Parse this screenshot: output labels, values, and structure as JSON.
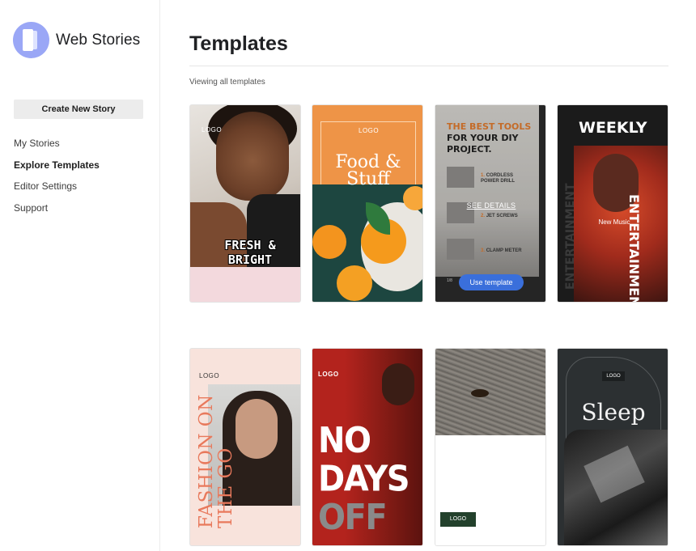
{
  "sidebar": {
    "brand": "Web Stories",
    "create_button": "Create New Story",
    "nav": [
      "My Stories",
      "Explore Templates",
      "Editor Settings",
      "Support"
    ],
    "active_index": 1
  },
  "main": {
    "title": "Templates",
    "viewing": "Viewing all templates",
    "templates": [
      {
        "logo": "LOGO",
        "headline": "FRESH & BRIGHT"
      },
      {
        "logo": "LOGO",
        "headline": "Food & Stuff"
      },
      {
        "headline_accent": "THE BEST TOOLS",
        "headline": "FOR YOUR DIY PROJECT.",
        "items": [
          {
            "n": "1.",
            "label": "CORDLESS POWER DRILL"
          },
          {
            "n": "2.",
            "label": "JET SCREWS"
          },
          {
            "n": "3.",
            "label": "CLAMP METER"
          }
        ],
        "see_details": "SEE DETAILS",
        "use_template": "Use template",
        "page": "1/8"
      },
      {
        "headline": "WEEKLY",
        "side_right": "ENTERTAINMENT",
        "side_left": "ENTERTAINMENT",
        "badge": "New Music"
      },
      {
        "logo": "LOGO",
        "headline": "FASHION ON THE GO"
      },
      {
        "logo": "LOGO",
        "line1": "NO",
        "line2": "DAYS",
        "line3": "OFF"
      },
      {
        "logo": "LOGO"
      },
      {
        "logo": "LOGO",
        "headline": "Sleep"
      }
    ]
  },
  "colors": {
    "brand": "#9aa7f6",
    "button_bg": "#ececec",
    "use_template": "#3a6fdb",
    "food_orange": "#ee9447",
    "nodays_red": "#b3231d",
    "fashion_accent": "#e8795c"
  }
}
